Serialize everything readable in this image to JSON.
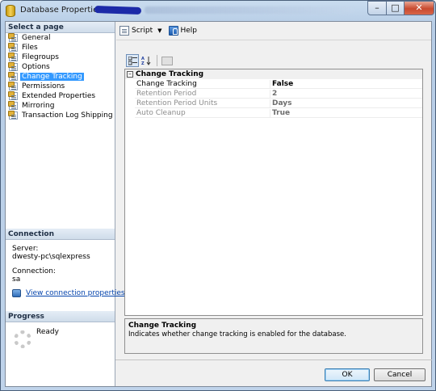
{
  "window": {
    "title": "Database Properties - ",
    "controls": {
      "minimize": "–",
      "maximize": "□",
      "close": "✕"
    }
  },
  "sidebar": {
    "select_page_header": "Select a page",
    "items": [
      {
        "label": "General",
        "icon": "page-icon"
      },
      {
        "label": "Files",
        "icon": "page-icon"
      },
      {
        "label": "Filegroups",
        "icon": "page-icon"
      },
      {
        "label": "Options",
        "icon": "page-icon"
      },
      {
        "label": "Change Tracking",
        "icon": "page-icon",
        "selected": true
      },
      {
        "label": "Permissions",
        "icon": "page-icon"
      },
      {
        "label": "Extended Properties",
        "icon": "page-icon"
      },
      {
        "label": "Mirroring",
        "icon": "page-icon"
      },
      {
        "label": "Transaction Log Shipping",
        "icon": "page-icon"
      }
    ],
    "connection": {
      "header": "Connection",
      "server_label": "Server:",
      "server_value": "dwesty-pc\\sqlexpress",
      "connection_label": "Connection:",
      "connection_value": "sa",
      "view_link": "View connection properties"
    },
    "progress": {
      "header": "Progress",
      "status": "Ready"
    }
  },
  "toolbar": {
    "script_label": "Script",
    "help_label": "Help"
  },
  "property_grid": {
    "category": "Change Tracking",
    "rows": [
      {
        "name": "Change Tracking",
        "value": "False",
        "enabled": true
      },
      {
        "name": "Retention Period",
        "value": "2",
        "enabled": false
      },
      {
        "name": "Retention Period Units",
        "value": "Days",
        "enabled": false
      },
      {
        "name": "Auto Cleanup",
        "value": "True",
        "enabled": false
      }
    ]
  },
  "description": {
    "title": "Change Tracking",
    "text": "Indicates whether change tracking is enabled for the database."
  },
  "buttons": {
    "ok": "OK",
    "cancel": "Cancel"
  },
  "colors": {
    "selection": "#3399ff",
    "link": "#0645ad",
    "title_bar": "#c9dcef"
  }
}
